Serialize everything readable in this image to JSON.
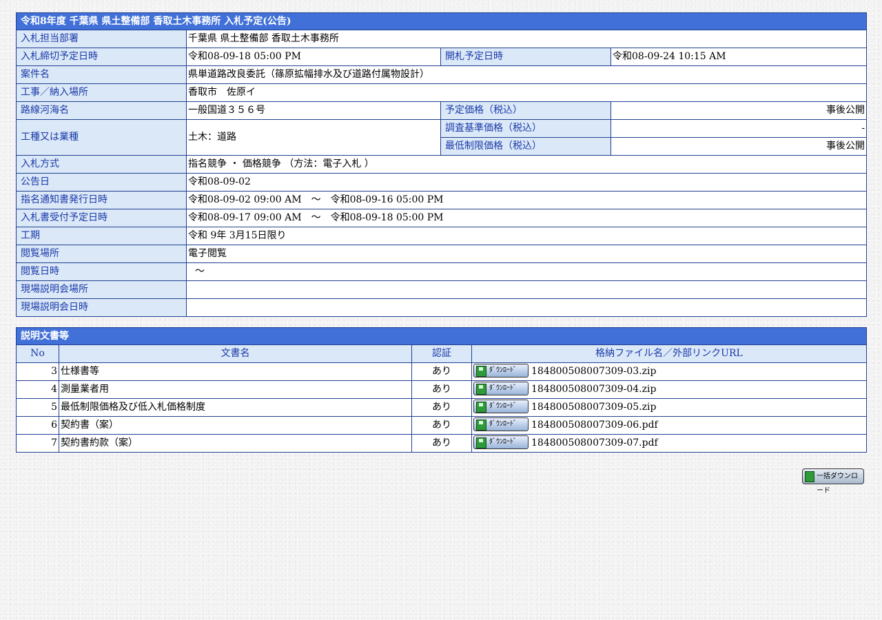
{
  "info": {
    "title": "令和8年度 千葉県 県土整備部 香取土木事務所 入札予定(公告)",
    "dept_label": "入札担当部署",
    "dept_value": "千葉県 県土整備部 香取土木事務所",
    "deadline_label": "入札締切予定日時",
    "deadline_value": "令和08-09-18 05:00 PM",
    "opening_label": "開札予定日時",
    "opening_value": "令和08-09-24 10:15 AM",
    "case_label": "案件名",
    "case_value": "県単道路改良委託（篠原拡幅排水及び道路付属物設計）",
    "place_label": "工事／納入場所",
    "place_value": "香取市　佐原イ",
    "route_label": "路線河海名",
    "route_value": "一般国道３５６号",
    "planned_price_label": "予定価格（税込）",
    "planned_price_value": "事後公開",
    "type_label": "工種又は業種",
    "type_value": "土木：道路",
    "survey_price_label": "調査基準価格（税込）",
    "survey_price_value": "-",
    "min_price_label": "最低制限価格（税込）",
    "min_price_value": "事後公開",
    "method_label": "入札方式",
    "method_value": "指名競争 ・ 価格競争 （方法：電子入札 ）",
    "notice_label": "公告日",
    "notice_value": "令和08-09-02",
    "nomination_label": "指名通知書発行日時",
    "nomination_value": "令和08-09-02 09:00 AM　～　令和08-09-16 05:00 PM",
    "accept_label": "入札書受付予定日時",
    "accept_value": "令和08-09-17 09:00 AM　～　令和08-09-18 05:00 PM",
    "period_label": "工期",
    "period_value": "令和 9年 3月15日限り",
    "view_place_label": "閲覧場所",
    "view_place_value": "電子閲覧",
    "view_date_label": "閲覧日時",
    "view_date_value": "～",
    "site_place_label": "現場説明会場所",
    "site_place_value": "",
    "site_date_label": "現場説明会日時",
    "site_date_value": ""
  },
  "docs": {
    "title": "説明文書等",
    "headers": {
      "no": "No",
      "name": "文書名",
      "auth": "認証",
      "file": "格納ファイル名／外部リンクURL"
    },
    "download_label": "ﾀﾞｳﾝﾛｰﾄﾞ",
    "rows": [
      {
        "no": "3",
        "name": "仕様書等",
        "auth": "あり",
        "file": "184800508007309-03.zip"
      },
      {
        "no": "4",
        "name": "測量業者用",
        "auth": "あり",
        "file": "184800508007309-04.zip"
      },
      {
        "no": "5",
        "name": "最低制限価格及び低入札価格制度",
        "auth": "あり",
        "file": "184800508007309-05.zip"
      },
      {
        "no": "6",
        "name": "契約書（案）",
        "auth": "あり",
        "file": "184800508007309-06.pdf"
      },
      {
        "no": "7",
        "name": "契約書約款（案）",
        "auth": "あり",
        "file": "184800508007309-07.pdf"
      }
    ]
  },
  "bulk_download_label": "一括ダウンロード",
  "colors": {
    "title_bar": "#4070d8",
    "label_bg": "#dbe8f8",
    "label_text": "#1a3aa8",
    "border": "#1f3f8f"
  }
}
